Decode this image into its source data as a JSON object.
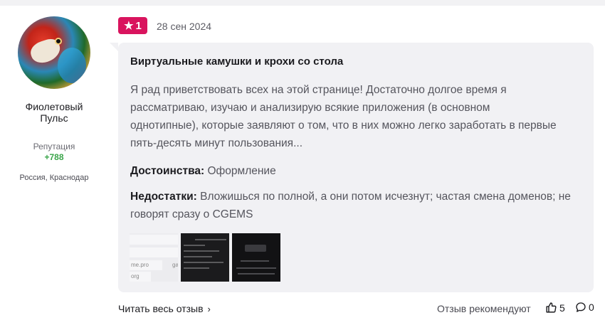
{
  "author": {
    "name_line1": "Фиолетовый",
    "name_line2": "Пульс",
    "reputation_label": "Репутация",
    "reputation_value": "+788",
    "location": "Россия, Краснодар"
  },
  "review": {
    "rating": "1",
    "rating_color": "#d9145e",
    "date": "28 сен 2024",
    "title": "Виртуальные камушки и крохи со стола",
    "text": "Я рад приветствовать всех на этой странице! Достаточно долгое время я рассматриваю, изучаю и анализирую всякие приложения (в основном однотипные), которые заявляют о том, что в них можно легко заработать в первые пять-десять минут пользования...",
    "pros_label": "Достоинства:",
    "pros_text": " Оформление",
    "cons_label": "Недостатки:",
    "cons_text": " Вложишься по полной, а они потом исчезнут; частая смена доменов; не говорят сразу о CGEMS",
    "thumbnails": [
      {
        "texts": [
          "me.pro",
          "ga",
          "org"
        ]
      },
      {
        "texts": []
      },
      {
        "texts": []
      }
    ]
  },
  "footer": {
    "read_more": "Читать весь отзыв",
    "recommends": "Отзыв рекомендуют",
    "likes": "5",
    "comments": "0"
  },
  "icons": {
    "star": "star-icon",
    "chevron": "chevron-right-icon",
    "like": "thumbs-up-icon",
    "comment": "comment-icon"
  }
}
